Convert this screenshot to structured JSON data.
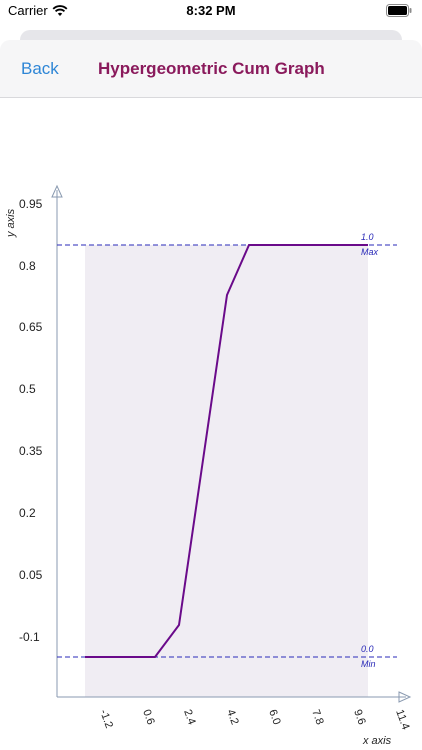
{
  "status_bar": {
    "carrier": "Carrier",
    "time": "8:32 PM",
    "icons": [
      "wifi-icon",
      "battery-icon"
    ]
  },
  "nav": {
    "back_label": "Back",
    "title": "Hypergeometric Cum Graph",
    "title_color": "#8a1a5c",
    "back_color": "#2e86d6"
  },
  "chart_data": {
    "type": "line",
    "title": "",
    "xlabel": "x axis",
    "ylabel": "y axis",
    "xlim": [
      -2.2,
      11.4
    ],
    "ylim": [
      -0.22,
      0.95
    ],
    "x_ticks": [
      "-1.2",
      "0.6",
      "2.4",
      "4.2",
      "6.0",
      "7.8",
      "9.6",
      "11.4"
    ],
    "y_ticks": [
      "0.95",
      "0.8",
      "0.65",
      "0.5",
      "0.35",
      "0.2",
      "0.05",
      "-0.1"
    ],
    "series": [
      {
        "x": [
          -1.5,
          1.6,
          2.6,
          3.3,
          4.2,
          5.0,
          10.0
        ],
        "y": [
          -0.15,
          -0.15,
          -0.1,
          0.25,
          0.7,
          0.8,
          0.8
        ]
      }
    ],
    "reference_lines": [
      {
        "y": 0.8,
        "label_top": "1.0",
        "label_bottom": "Max"
      },
      {
        "y": -0.15,
        "label_top": "0.0",
        "label_bottom": "Min"
      }
    ],
    "line_color": "#6a0a8a",
    "fill_color": "#f0edf3",
    "reference_color": "#2a2ab8",
    "grid": false
  }
}
